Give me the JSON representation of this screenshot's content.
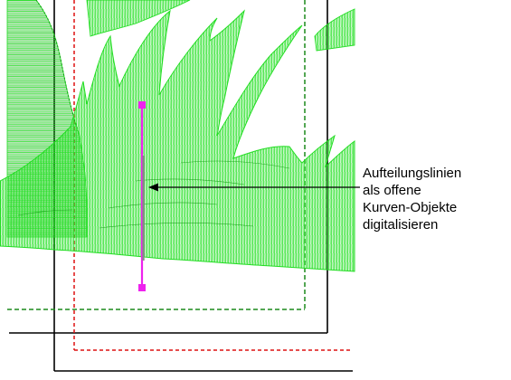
{
  "annotation": {
    "lines": [
      "Aufteilungslinien",
      "als offene",
      "Kurven-Objekte",
      "digitalisieren"
    ]
  },
  "colors": {
    "stitch_fill": "#22dd22",
    "stitch_dark": "#119911",
    "outline_green": "#1c8a1c",
    "outline_red": "#dd1111",
    "frame_black": "#000000",
    "selection_magenta": "#ee22ee",
    "selection_gray": "#8a8a8a",
    "background": "#ffffff"
  },
  "icons": {
    "selection_handle": "square-handle-icon",
    "pointer": "arrow-left-icon"
  }
}
